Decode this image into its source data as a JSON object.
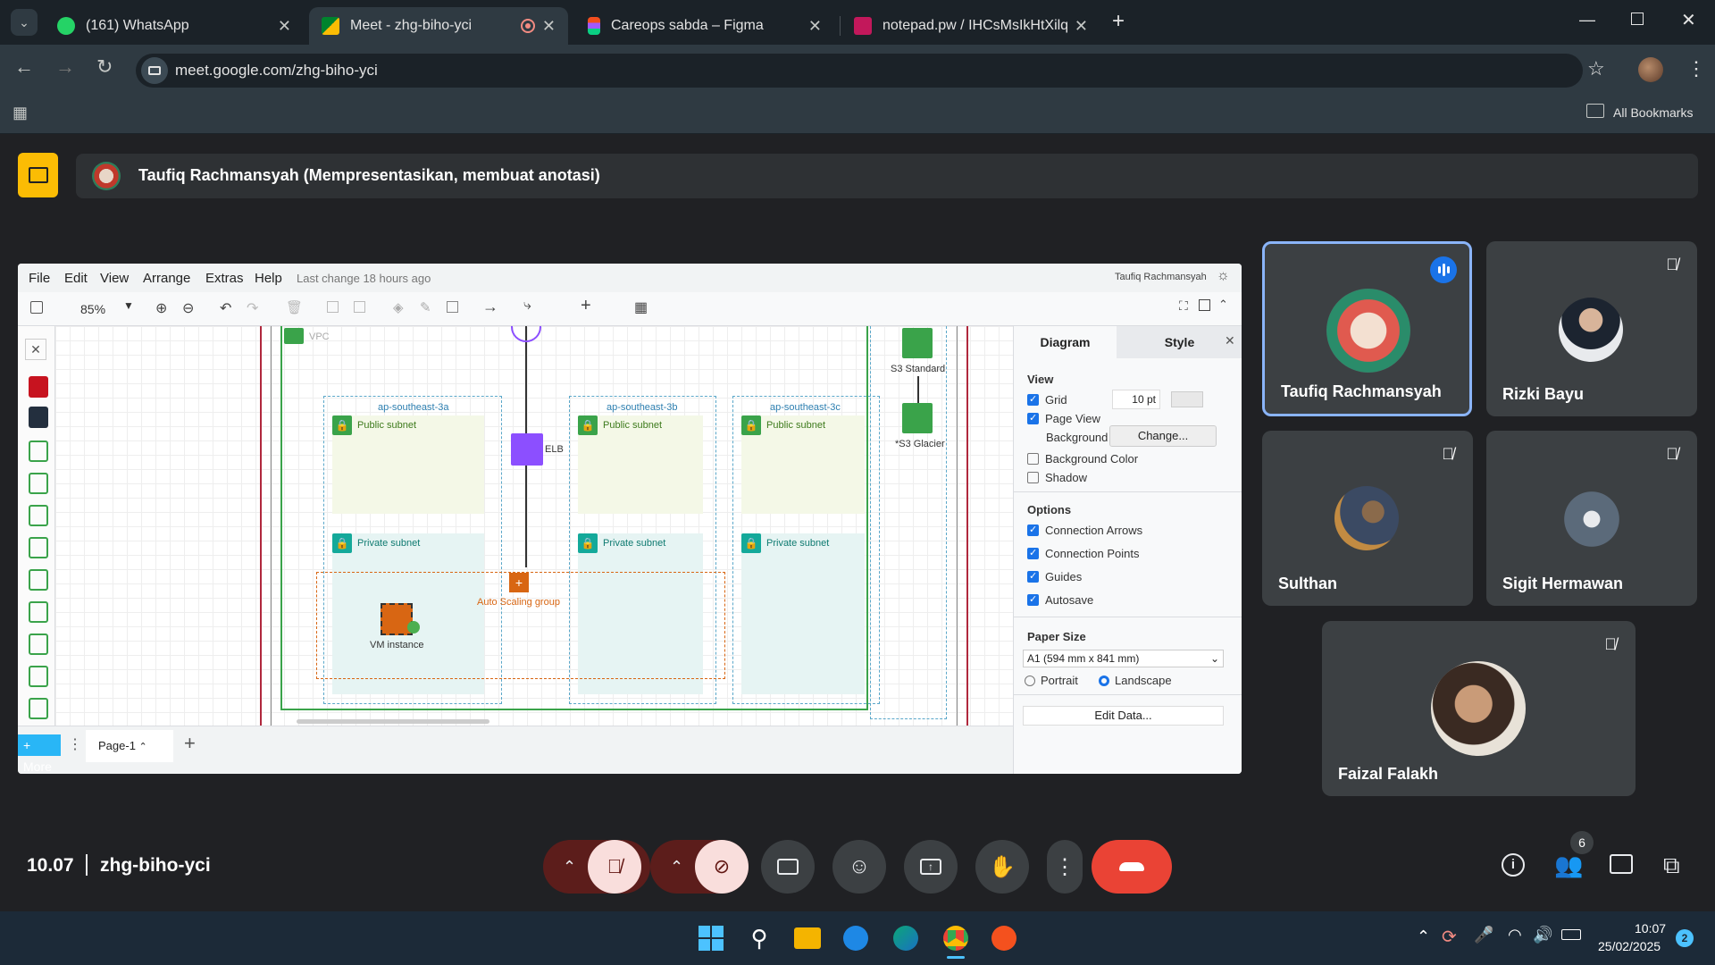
{
  "browser": {
    "tabs": [
      {
        "title": "(161) WhatsApp",
        "icon": "whatsapp-icon",
        "active": false
      },
      {
        "title": "Meet - zhg-biho-yci",
        "icon": "meet-icon",
        "active": true
      },
      {
        "title": "Careops sabda – Figma",
        "icon": "figma-icon",
        "active": false
      },
      {
        "title": "notepad.pw / IHCsMsIkHtXilqID",
        "icon": "notepad-icon",
        "active": false
      }
    ],
    "url": "meet.google.com/zhg-biho-yci",
    "bookmarks_label": "All Bookmarks"
  },
  "meet": {
    "presenter_banner": "Taufiq Rachmansyah (Mempresentasikan, membuat anotasi)",
    "time": "10.07",
    "meeting_code": "zhg-biho-yci",
    "people_count": "6",
    "participants": [
      {
        "name": "Taufiq Rachmansyah",
        "speaking": true,
        "muted": false
      },
      {
        "name": "Rizki Bayu",
        "speaking": false,
        "muted": true
      },
      {
        "name": "Sulthan",
        "speaking": false,
        "muted": true
      },
      {
        "name": "Sigit Hermawan",
        "speaking": false,
        "muted": true
      },
      {
        "name": "Faizal Falakh",
        "speaking": false,
        "muted": true
      }
    ]
  },
  "drawio": {
    "menu": [
      "File",
      "Edit",
      "View",
      "Arrange",
      "Extras",
      "Help"
    ],
    "last_change": "Last change 18 hours ago",
    "user": "Taufiq Rachmansyah",
    "zoom": "85%",
    "more_label": "More",
    "page_tab": "Page-1",
    "diagram": {
      "vpc": "VPC",
      "zones": [
        "ap-southeast-3a",
        "ap-southeast-3b",
        "ap-southeast-3c"
      ],
      "public_subnet": "Public subnet",
      "private_subnet": "Private subnet",
      "elb": "ELB",
      "asg": "Auto Scaling group",
      "vm": "VM instance",
      "s3_standard": "S3 Standard",
      "s3_glacier": "*S3 Glacier"
    },
    "format_panel": {
      "tabs": [
        "Diagram",
        "Style"
      ],
      "view_heading": "View",
      "grid_label": "Grid",
      "grid_size": "10 pt",
      "page_view_label": "Page View",
      "background_label": "Background",
      "change_button": "Change...",
      "bg_color_label": "Background Color",
      "shadow_label": "Shadow",
      "options_heading": "Options",
      "options": [
        "Connection Arrows",
        "Connection Points",
        "Guides",
        "Autosave"
      ],
      "paper_heading": "Paper Size",
      "paper_value": "A1 (594 mm x 841 mm)",
      "portrait": "Portrait",
      "landscape": "Landscape",
      "edit_data": "Edit Data..."
    }
  },
  "taskbar": {
    "time": "10:07",
    "date": "25/02/2025",
    "notification_count": "2"
  },
  "colors": {
    "end_call": "#ea4335",
    "muted_btn": "#f9dedc",
    "speaking_border": "#8ab4f8",
    "aws_green": "#3aa34a",
    "aws_orange": "#d86613"
  }
}
